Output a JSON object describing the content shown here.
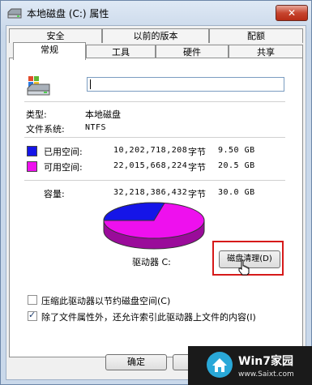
{
  "window": {
    "title": "本地磁盘 (C:) 属性",
    "close_label": "✕"
  },
  "tabs_back": [
    {
      "label": "安全"
    },
    {
      "label": "以前的版本"
    },
    {
      "label": "配额"
    }
  ],
  "tabs_front": [
    {
      "label": "常规"
    },
    {
      "label": "工具"
    },
    {
      "label": "硬件"
    },
    {
      "label": "共享"
    }
  ],
  "general": {
    "volume_name_value": "",
    "type_label": "类型:",
    "type_value": "本地磁盘",
    "fs_label": "文件系统:",
    "fs_value": "NTFS",
    "used": {
      "label": "已用空间:",
      "bytes": "10,202,718,208",
      "unit": "字节",
      "size": "9.50 GB",
      "color": "#1515e8"
    },
    "free": {
      "label": "可用空间:",
      "bytes": "22,015,668,224",
      "unit": "字节",
      "size": "20.5 GB",
      "color": "#ee10ee"
    },
    "capacity": {
      "label": "容量:",
      "bytes": "32,218,386,432",
      "unit": "字节",
      "size": "30.0 GB"
    },
    "drive_label": "驱动器 C:",
    "cleanup_button": "磁盘清理(D)",
    "compress_label": "压缩此驱动器以节约磁盘空间(C)",
    "compress_checked": false,
    "index_label": "除了文件属性外，还允许索引此驱动器上文件的内容(I)",
    "index_checked": true
  },
  "footer": {
    "ok_label": "确定"
  },
  "watermark": {
    "brand": "Win7家园",
    "url": "www.Saixt.com"
  }
}
